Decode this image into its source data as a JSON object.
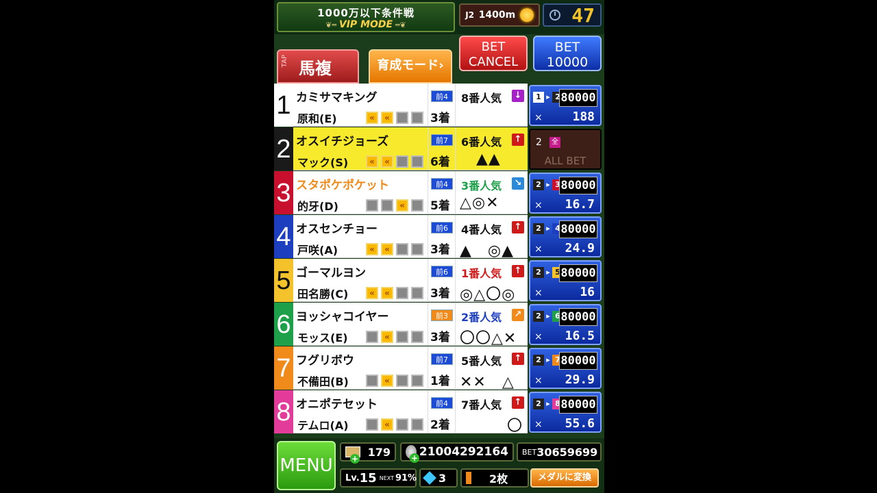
{
  "header": {
    "title": "1000万以下条件戦",
    "mode": "VIP MODE",
    "course_class": "J2",
    "distance": "1400m",
    "timer": "47"
  },
  "betbar": {
    "tap_label": "TAP",
    "bet_type": "馬複",
    "training_mode": "育成モード",
    "cancel_line1": "BET",
    "cancel_line2": "CANCEL",
    "bet_line1": "BET",
    "bet_line2": "10000"
  },
  "colors": {
    "n1": "#ffffff",
    "n2": "#1a1a1a",
    "n3": "#c8102e",
    "n4": "#1d3fbf",
    "n5": "#f4c22b",
    "n6": "#1ea04a",
    "n7": "#f08a1b",
    "n8": "#e23b9a"
  },
  "horses": [
    {
      "num": "1",
      "name": "カミサマキング",
      "jockey": "原和(E)",
      "prev": "前4",
      "place": "3着",
      "pop": "8番人気",
      "marks": "",
      "combo_a": "1",
      "combo_b": "2",
      "bet": "80000",
      "odds": "188"
    },
    {
      "num": "2",
      "name": "オスイチジョーズ",
      "jockey": "マック(S)",
      "prev": "前7",
      "place": "6着",
      "pop": "6番人気",
      "marks": "▲▲",
      "allbet_num": "2",
      "allbet_zen": "全",
      "allbet_text": "ALL BET"
    },
    {
      "num": "3",
      "name": "スタポケポケット",
      "jockey": "的牙(D)",
      "prev": "前4",
      "place": "5着",
      "pop": "3番人気",
      "marks": "△◎✕",
      "combo_a": "2",
      "combo_b": "3",
      "bet": "80000",
      "odds": "16.7"
    },
    {
      "num": "4",
      "name": "オスセンチョー",
      "jockey": "戸咲(A)",
      "prev": "前6",
      "place": "3着",
      "pop": "4番人気",
      "marks": "▲　◎▲",
      "combo_a": "2",
      "combo_b": "4",
      "bet": "80000",
      "odds": "24.9"
    },
    {
      "num": "5",
      "name": "ゴーマルヨン",
      "jockey": "田名勝(C)",
      "prev": "前6",
      "place": "3着",
      "pop": "1番人気",
      "marks": "◎△〇◎",
      "combo_a": "2",
      "combo_b": "5",
      "bet": "80000",
      "odds": "16"
    },
    {
      "num": "6",
      "name": "ヨッシャコイヤー",
      "jockey": "モッス(E)",
      "prev": "前3",
      "place": "3着",
      "pop": "2番人気",
      "marks": "〇〇△✕",
      "combo_a": "2",
      "combo_b": "6",
      "bet": "80000",
      "odds": "16.5"
    },
    {
      "num": "7",
      "name": "フグリボウ",
      "jockey": "不備田(B)",
      "prev": "前7",
      "place": "1着",
      "pop": "5番人気",
      "marks": "✕✕　△",
      "combo_a": "2",
      "combo_b": "7",
      "bet": "80000",
      "odds": "29.9"
    },
    {
      "num": "8",
      "name": "オニポテセット",
      "jockey": "テムロ(A)",
      "prev": "前4",
      "place": "2着",
      "pop": "7番人気",
      "marks": "　　　〇",
      "combo_a": "2",
      "combo_b": "8",
      "bet": "80000",
      "odds": "55.6"
    }
  ],
  "footer": {
    "menu": "MENU",
    "tickets": "179",
    "medals": "21004292164",
    "bet_label": "BET",
    "bet_total": "30659699",
    "level_label": "Lv.",
    "level": "15",
    "next_label": "NEXT",
    "next_pct": "91%",
    "gems": "3",
    "cards": "2枚",
    "convert": "メダルに変換"
  }
}
